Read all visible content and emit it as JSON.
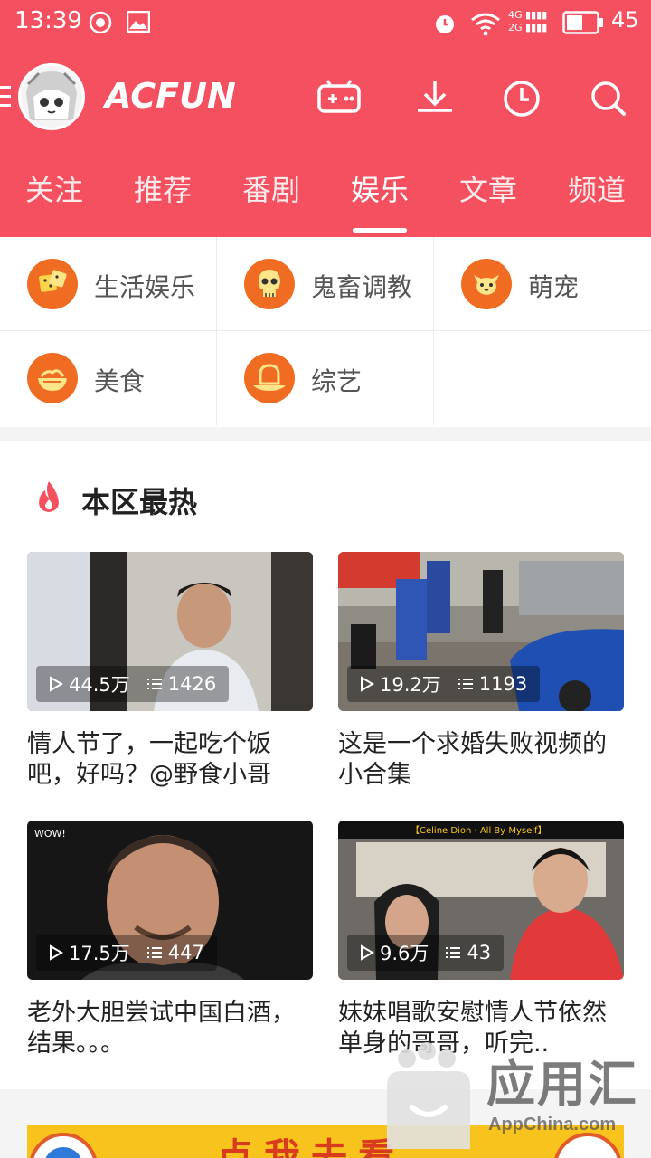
{
  "status_bar": {
    "time": "13:39",
    "battery": "45",
    "network_top": "4G",
    "network_bottom": "2G"
  },
  "app": {
    "logo": "ACFUN"
  },
  "tabs": [
    {
      "label": "关注"
    },
    {
      "label": "推荐"
    },
    {
      "label": "番剧"
    },
    {
      "label": "娱乐",
      "active": true
    },
    {
      "label": "文章"
    },
    {
      "label": "频道"
    }
  ],
  "categories": [
    {
      "label": "生活娱乐",
      "icon": "dice-icon"
    },
    {
      "label": "鬼畜调教",
      "icon": "skull-icon"
    },
    {
      "label": "萌宠",
      "icon": "cat-icon"
    },
    {
      "label": "美食",
      "icon": "bowl-icon"
    },
    {
      "label": "综艺",
      "icon": "hat-icon"
    }
  ],
  "hot": {
    "title": "本区最热",
    "videos": [
      {
        "views": "44.5万",
        "comments": "1426",
        "title": "情人节了，一起吃个饭吧，好吗？@野食小哥"
      },
      {
        "views": "19.2万",
        "comments": "1193",
        "title": "这是一个求婚失败视频的小合集"
      },
      {
        "views": "17.5万",
        "comments": "447",
        "title": "老外大胆尝试中国白酒，结果。。。"
      },
      {
        "views": "9.6万",
        "comments": "43",
        "title": "妹妹唱歌安慰情人节依然单身的哥哥，听完.."
      }
    ]
  },
  "thumb_text": {
    "wow": "WOW!",
    "song": "【Celine Dion · All By Myself】"
  },
  "banner": {
    "text": "点我去看"
  },
  "watermark": {
    "title": "应用汇",
    "sub": "AppChina.com"
  },
  "colors": {
    "brand": "#f5505f",
    "category_icon": "#f06c22"
  }
}
